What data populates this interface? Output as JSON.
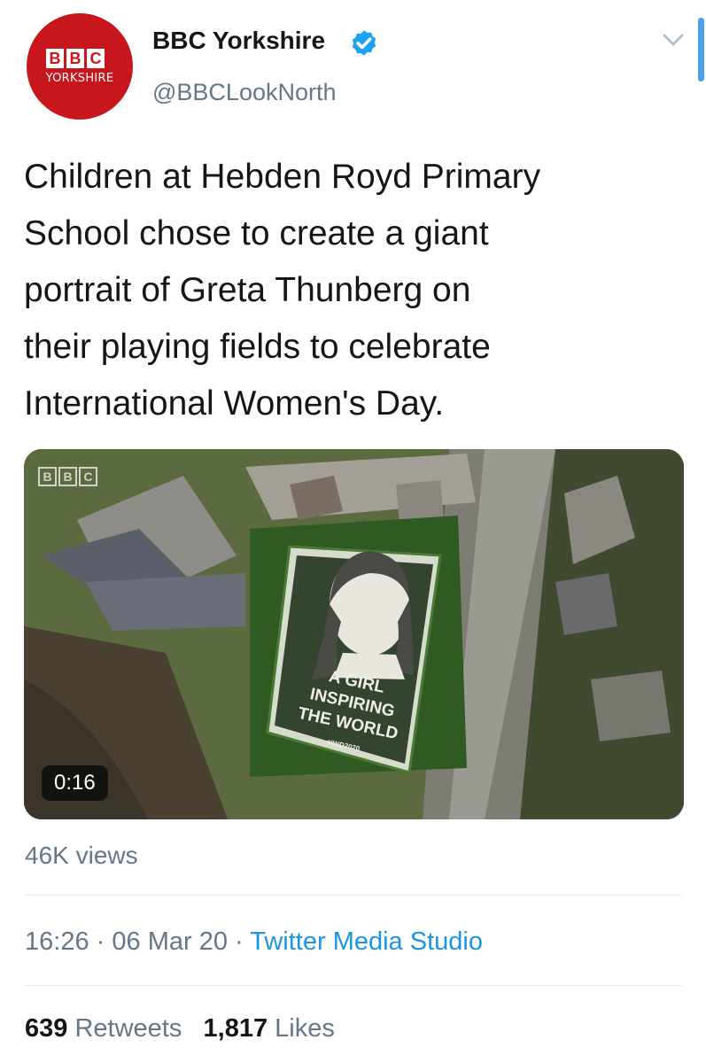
{
  "author": {
    "avatar": {
      "logo_letters": [
        "B",
        "B",
        "C"
      ],
      "subtitle": "YORKSHIRE"
    },
    "name": "BBC Yorkshire",
    "handle": "@BBCLookNorth",
    "verified": true
  },
  "tweet": {
    "text": "Children at Hebden Royd Primary\nSchool chose to create a giant\nportrait of Greta Thunberg on\ntheir playing fields to celebrate\nInternational Women's Day."
  },
  "media": {
    "watermark_letters": [
      "B",
      "B",
      "C"
    ],
    "portrait_caption_lines": [
      "A GIRL",
      "INSPIRING",
      "THE WORLD"
    ],
    "portrait_hashtag": "#IWD2020",
    "duration": "0:16"
  },
  "views": "46K views",
  "meta": {
    "time": "16:26",
    "separator": "·",
    "date": "06 Mar 20",
    "source": "Twitter Media Studio"
  },
  "stats": {
    "retweets_count": "639",
    "retweets_label": "Retweets",
    "likes_count": "1,817",
    "likes_label": "Likes"
  },
  "colors": {
    "link": "#1b95e0",
    "secondary_text": "#657786",
    "verified_badge": "#1da1f2",
    "bbc_red": "#c8171c"
  },
  "icons": [
    "verified-badge-icon",
    "chevron-down-icon"
  ]
}
